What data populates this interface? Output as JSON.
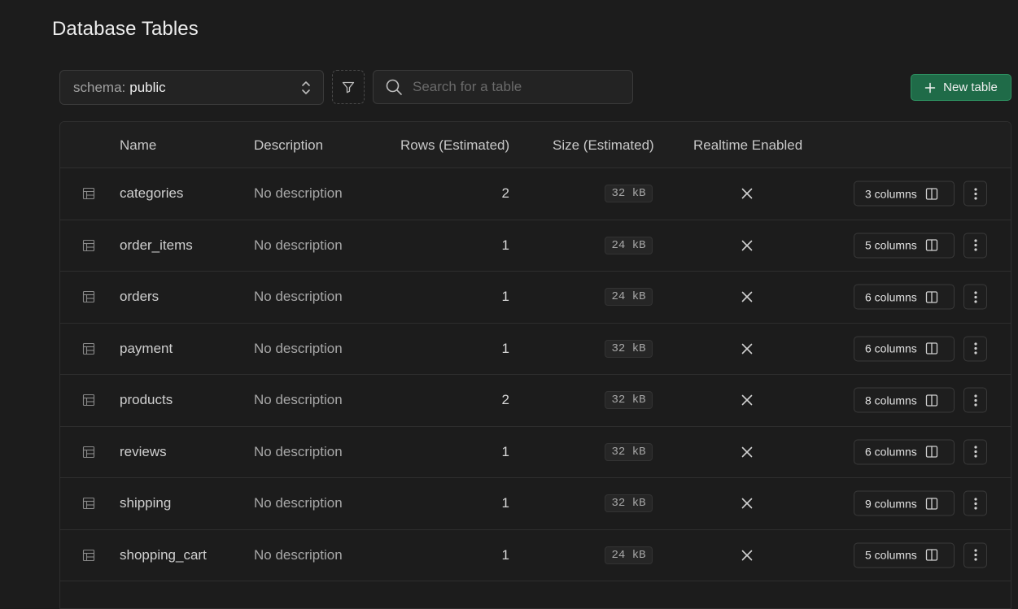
{
  "page": {
    "title": "Database Tables"
  },
  "toolbar": {
    "schema_prefix": "schema:",
    "schema_value": "public",
    "search_placeholder": "Search for a table",
    "new_table_label": "New table"
  },
  "table": {
    "headers": {
      "name": "Name",
      "description": "Description",
      "rows": "Rows (Estimated)",
      "size": "Size (Estimated)",
      "realtime": "Realtime Enabled"
    },
    "rows": [
      {
        "name": "categories",
        "description": "No description",
        "rows": "2",
        "size": "32 kB",
        "columns": "3 columns"
      },
      {
        "name": "order_items",
        "description": "No description",
        "rows": "1",
        "size": "24 kB",
        "columns": "5 columns"
      },
      {
        "name": "orders",
        "description": "No description",
        "rows": "1",
        "size": "24 kB",
        "columns": "6 columns"
      },
      {
        "name": "payment",
        "description": "No description",
        "rows": "1",
        "size": "32 kB",
        "columns": "6 columns"
      },
      {
        "name": "products",
        "description": "No description",
        "rows": "2",
        "size": "32 kB",
        "columns": "8 columns"
      },
      {
        "name": "reviews",
        "description": "No description",
        "rows": "1",
        "size": "32 kB",
        "columns": "6 columns"
      },
      {
        "name": "shipping",
        "description": "No description",
        "rows": "1",
        "size": "32 kB",
        "columns": "9 columns"
      },
      {
        "name": "shopping_cart",
        "description": "No description",
        "rows": "1",
        "size": "24 kB",
        "columns": "5 columns"
      }
    ]
  },
  "colors": {
    "background": "#1c1c1c",
    "accent": "#1f6b48",
    "accent_border": "#2e9362"
  }
}
